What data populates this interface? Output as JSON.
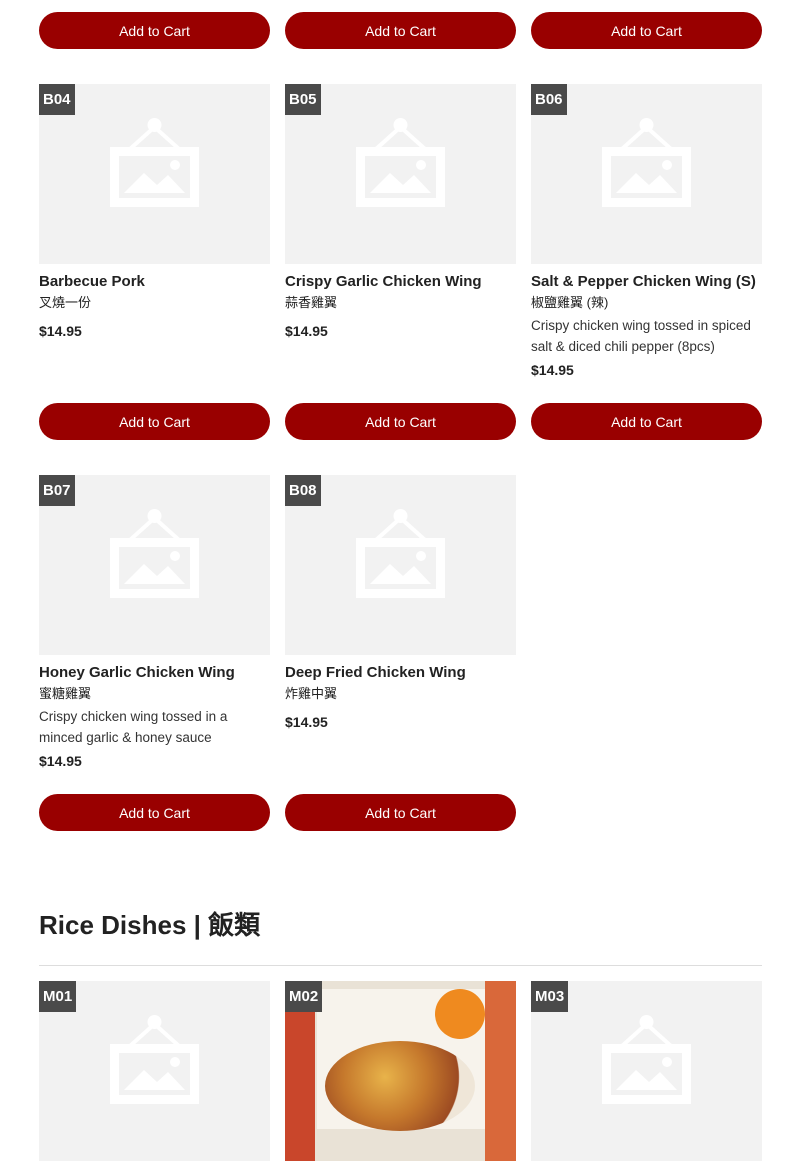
{
  "top_buttons": [
    "Add to Cart",
    "Add to Cart",
    "Add to Cart"
  ],
  "row_b1": [
    {
      "code": "B04",
      "name": "Barbecue Pork",
      "cn": "叉燒一份",
      "desc": "",
      "price": "$14.95",
      "button": "Add to Cart"
    },
    {
      "code": "B05",
      "name": "Crispy Garlic Chicken Wing",
      "cn": "蒜香雞翼",
      "desc": "",
      "price": "$14.95",
      "button": "Add to Cart"
    },
    {
      "code": "B06",
      "name": "Salt & Pepper Chicken Wing (S)",
      "cn": "椒鹽雞翼 (辣)",
      "desc": "Crispy chicken wing tossed in spiced salt & diced chili pepper (8pcs)",
      "price": "$14.95",
      "button": "Add to Cart"
    }
  ],
  "row_b2": [
    {
      "code": "B07",
      "name": "Honey Garlic Chicken Wing",
      "cn": "蜜糖雞翼",
      "desc": "Crispy chicken wing tossed in a minced garlic & honey sauce",
      "price": "$14.95",
      "button": "Add to Cart"
    },
    {
      "code": "B08",
      "name": "Deep Fried Chicken Wing",
      "cn": "炸雞中翼",
      "desc": "",
      "price": "$14.95",
      "button": "Add to Cart"
    }
  ],
  "section": {
    "title": "Rice Dishes | 飯類"
  },
  "row_m": [
    {
      "code": "M01",
      "photo": false
    },
    {
      "code": "M02",
      "photo": true
    },
    {
      "code": "M03",
      "photo": false
    }
  ],
  "colors": {
    "accent": "#990000",
    "badge": "#4a4a4a",
    "placeholder_bg": "#f2f2f2"
  }
}
